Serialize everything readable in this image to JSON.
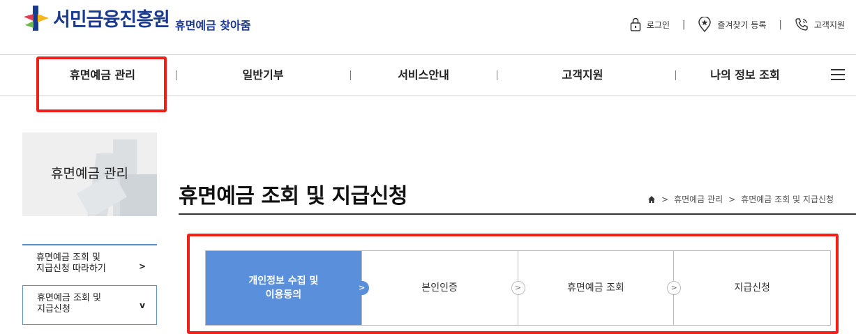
{
  "header": {
    "logo_text": "서민금융진흥원",
    "logo_sub": "휴면예금 찾아줌",
    "util": {
      "login": "로그인",
      "bookmark": "즐겨찾기 등록",
      "support": "고객지원"
    }
  },
  "gnb": {
    "items": [
      "휴면예금 관리",
      "일반기부",
      "서비스안내",
      "고객지원",
      "나의 정보 조회"
    ]
  },
  "side": {
    "title": "휴면예금 관리",
    "menu": [
      {
        "line1": "휴면예금 조회 및",
        "line2": "지급신청 따라하기",
        "arrow": ">"
      },
      {
        "line1": "휴면예금 조회 및",
        "line2": "지급신청",
        "arrow": "v"
      }
    ]
  },
  "content": {
    "title": "휴면예금 조회 및 지급신청",
    "breadcrumb": [
      "휴면예금 관리",
      "휴면예금 조회 및 지급신청"
    ],
    "breadcrumb_sep": ">",
    "steps": [
      {
        "line1": "개인정보 수집 및",
        "line2": "이용동의"
      },
      {
        "line1": "본인인증",
        "line2": ""
      },
      {
        "line1": "휴면예금 조회",
        "line2": ""
      },
      {
        "line1": "지급신청",
        "line2": ""
      }
    ],
    "step_arrow": ">"
  },
  "colors": {
    "brand": "#1a3a8f",
    "active_step": "#5a8fdc",
    "highlight": "#f02018"
  }
}
